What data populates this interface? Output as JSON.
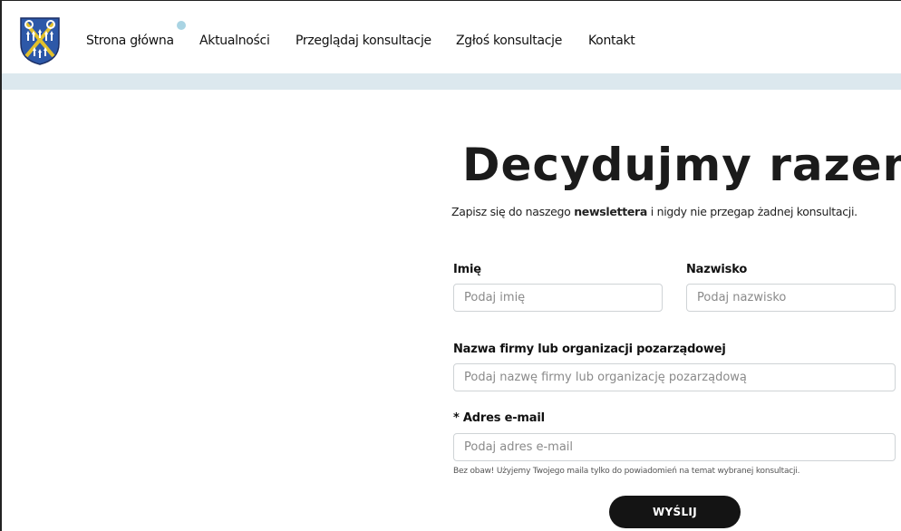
{
  "header": {
    "logo_alt": "Herb",
    "nav": [
      {
        "label": "Strona główna"
      },
      {
        "label": "Aktualności"
      },
      {
        "label": "Przeglądaj konsultacje"
      },
      {
        "label": "Zgłoś konsultacje"
      },
      {
        "label": "Kontakt"
      }
    ]
  },
  "hero": {
    "title": "Decydujmy razem!",
    "subtitle_before": "Zapisz się do naszego ",
    "subtitle_bold": "newslettera",
    "subtitle_after": " i nigdy nie przegap żadnej konsultacji."
  },
  "form": {
    "first_name_label": "Imię",
    "first_name_placeholder": "Podaj imię",
    "last_name_label": "Nazwisko",
    "last_name_placeholder": "Podaj nazwisko",
    "company_label": "Nazwa firmy lub organizacji pozarządowej",
    "company_placeholder": "Podaj nazwę firmy lub organizację pozarządową",
    "email_label": "* Adres e-mail",
    "email_placeholder": "Podaj adres e-mail",
    "email_hint": "Bez obaw! Użyjemy Twojego maila tylko do powiadomień na temat wybranej konsultacji.",
    "submit_label": "WYŚLIJ"
  },
  "colors": {
    "band": "#dce8ee",
    "accent_dot": "#a9d4e3",
    "button": "#141414",
    "crest_blue": "#2d58a8",
    "crest_gold": "#e3c12b"
  }
}
